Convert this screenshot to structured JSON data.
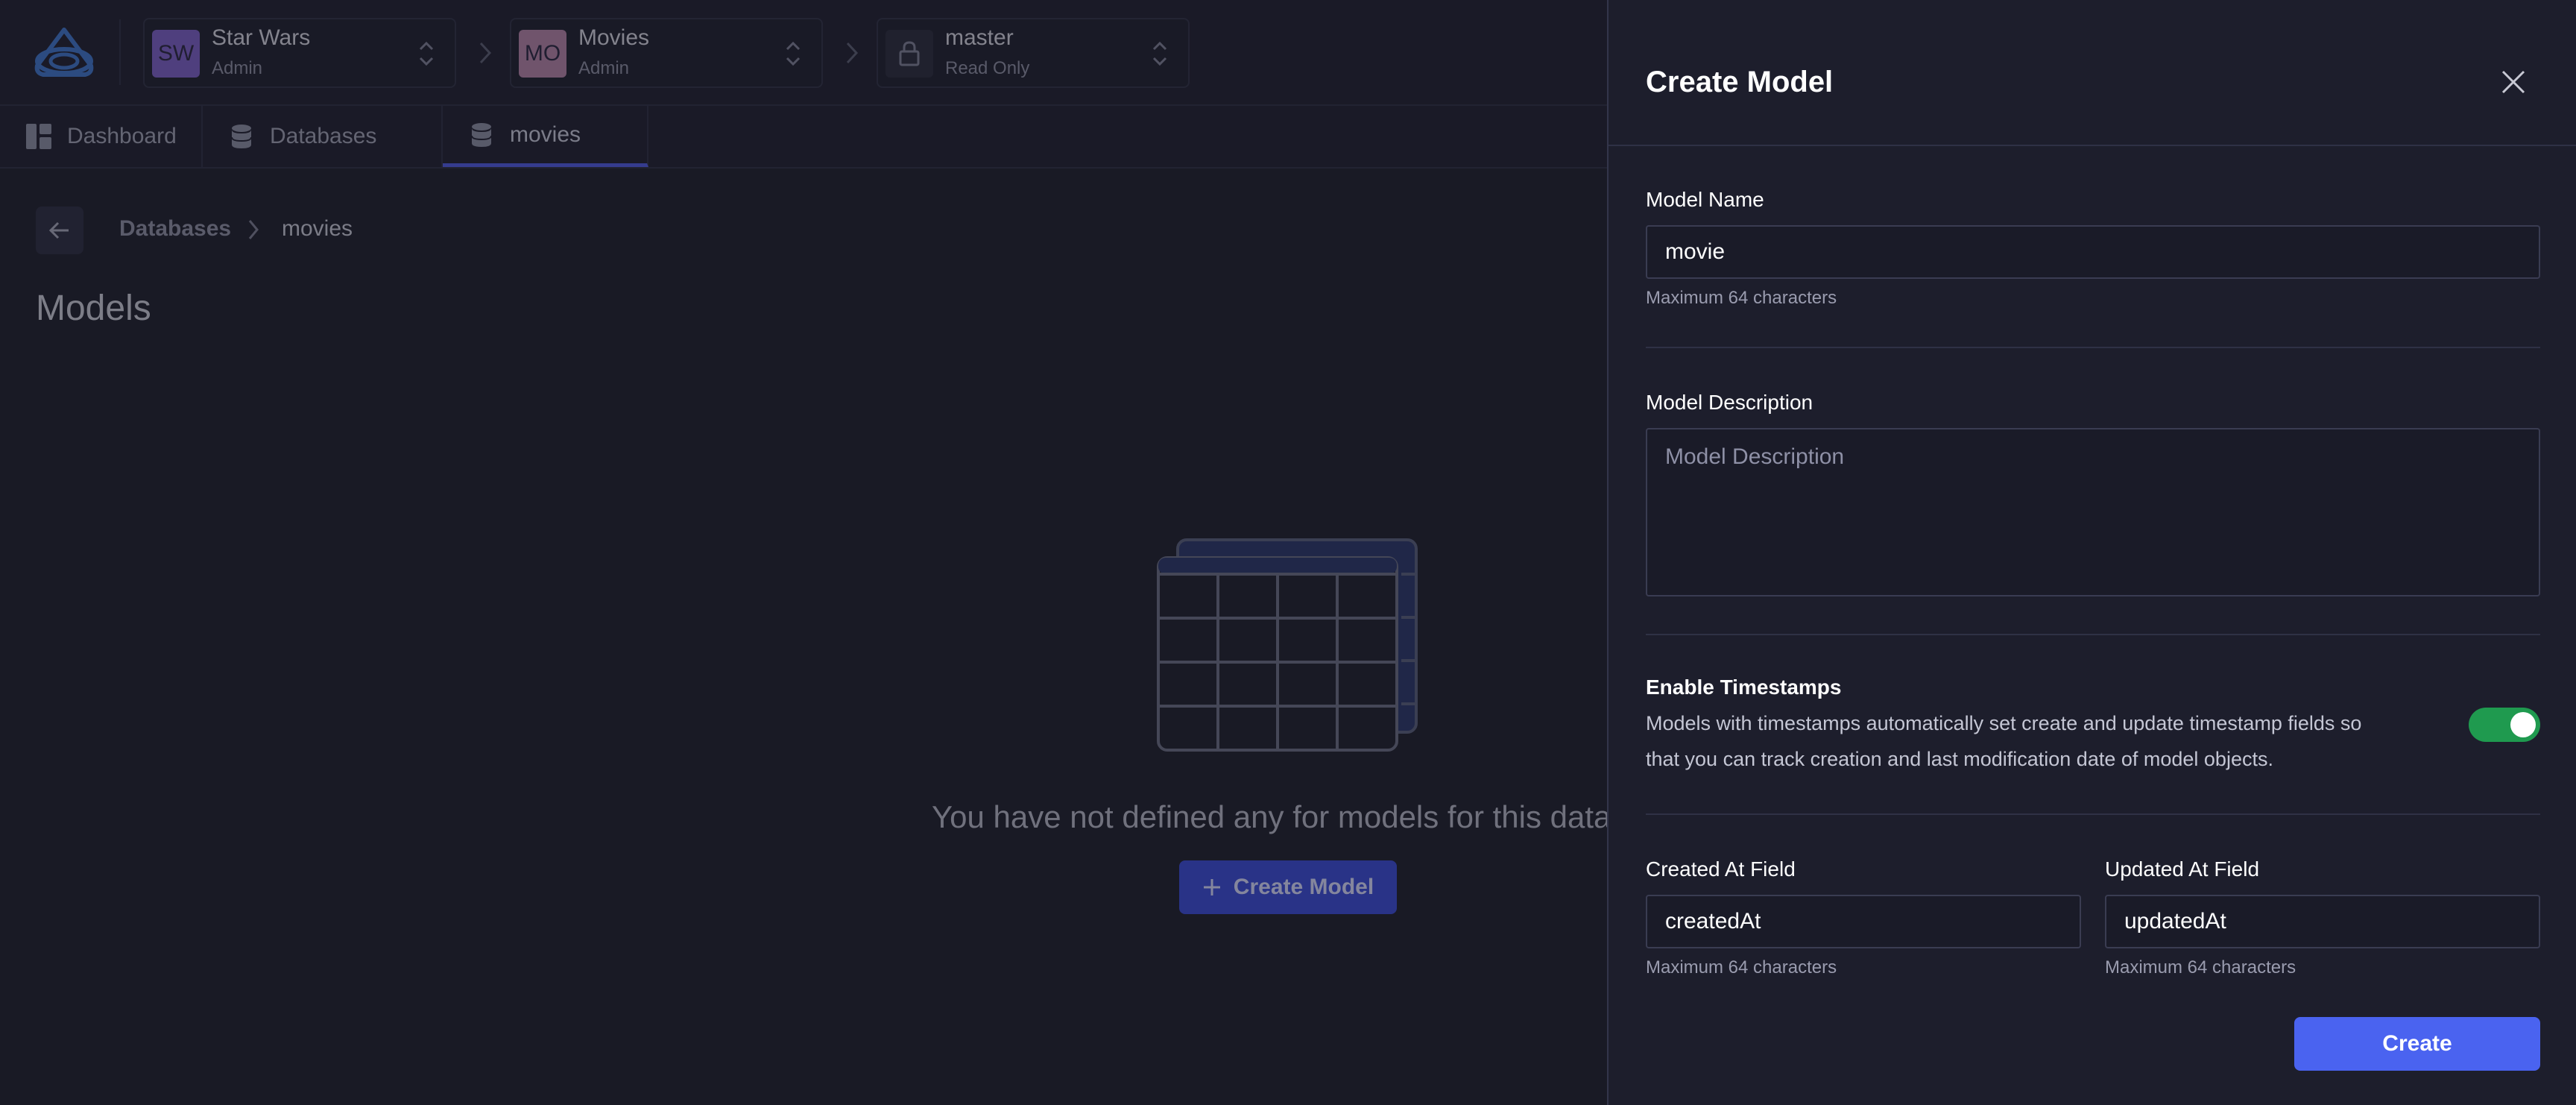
{
  "colors": {
    "accent": "#4a63f0",
    "toggle_on": "#1f9a4f",
    "drawer_bg": "#1d1e2c",
    "page_bg": "#1e1f2c"
  },
  "topbar": {
    "logo_icon": "app-logo-icon",
    "project": {
      "initials": "SW",
      "name": "Star Wars",
      "role": "Admin",
      "color": "#7a5fc4"
    },
    "environment": {
      "initials": "MO",
      "name": "Movies",
      "role": "Admin",
      "color": "#b483a6"
    },
    "branch": {
      "name": "master",
      "role": "Read Only",
      "icon": "lock-icon"
    }
  },
  "tabs": [
    {
      "label": "Dashboard",
      "icon": "dashboard-icon"
    },
    {
      "label": "Databases",
      "icon": "database-icon"
    },
    {
      "label": "movies",
      "icon": "database-icon",
      "active": true
    }
  ],
  "breadcrumb": {
    "parent": "Databases",
    "current": "movies"
  },
  "page": {
    "title": "Models"
  },
  "empty_state": {
    "message": "You have not defined any for models for this databa",
    "button_label": "Create Model"
  },
  "drawer": {
    "title": "Create Model",
    "model_name": {
      "label": "Model Name",
      "value": "movie",
      "hint": "Maximum 64 characters"
    },
    "model_description": {
      "label": "Model Description",
      "placeholder": "Model Description"
    },
    "timestamps": {
      "title": "Enable Timestamps",
      "description": "Models with timestamps automatically set create and update timestamp fields so that you can track creation and last modification date of model objects.",
      "enabled": true
    },
    "created_at": {
      "label": "Created At Field",
      "value": "createdAt",
      "hint": "Maximum 64 characters"
    },
    "updated_at": {
      "label": "Updated At Field",
      "value": "updatedAt",
      "hint": "Maximum 64 characters"
    },
    "submit_label": "Create"
  }
}
